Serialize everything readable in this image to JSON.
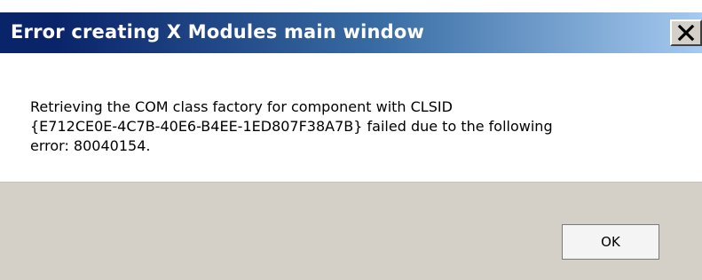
{
  "window": {
    "title": "Error creating X Modules main window",
    "close_icon": "close-icon"
  },
  "message": {
    "line1": "Retrieving the COM class factory for component with CLSID",
    "line2": "{E712CE0E-4C7B-40E6-B4EE-1ED807F38A7B} failed due to the following",
    "line3": "error: 80040154."
  },
  "buttons": {
    "ok_label": "OK"
  },
  "colors": {
    "titlebar_start": "#0a246a",
    "titlebar_end": "#a6caf0",
    "footer": "#d4d0c8"
  }
}
